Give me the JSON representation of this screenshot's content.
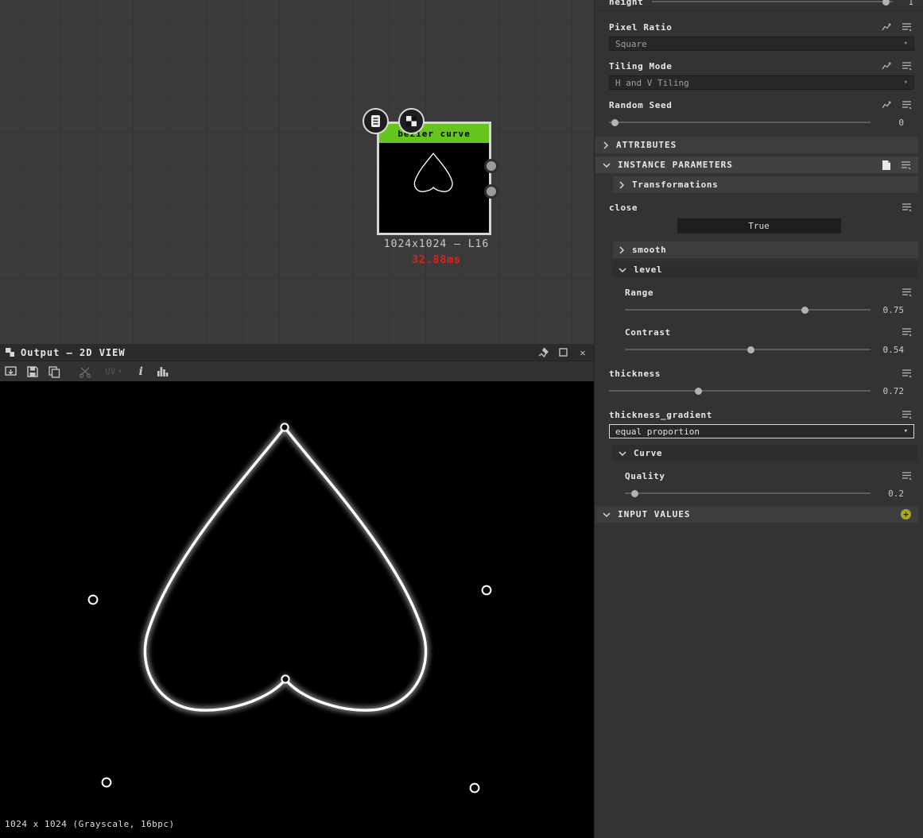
{
  "graph": {
    "node_title": "bezier curve",
    "node_resolution": "1024x1024 — L16",
    "node_time": "32.88ms"
  },
  "viewer": {
    "title": "Output — 2D VIEW",
    "uv_label": "UV",
    "status": "1024 x 1024 (Grayscale, 16bpc)"
  },
  "props": {
    "height": {
      "label": "height",
      "value": "1"
    },
    "pixel_ratio": {
      "label": "Pixel Ratio",
      "value": "Square"
    },
    "tiling_mode": {
      "label": "Tiling Mode",
      "value": "H and V Tiling"
    },
    "random_seed": {
      "label": "Random Seed",
      "value": "0"
    },
    "attributes": {
      "label": "ATTRIBUTES"
    },
    "instance_parameters": {
      "label": "INSTANCE PARAMETERS"
    },
    "transformations": {
      "label": "Transformations"
    },
    "close": {
      "label": "close",
      "value": "True"
    },
    "smooth": {
      "label": "smooth"
    },
    "level": {
      "label": "level"
    },
    "range": {
      "label": "Range",
      "value": "0.75"
    },
    "contrast": {
      "label": "Contrast",
      "value": "0.54"
    },
    "thickness": {
      "label": "thickness",
      "value": "0.72"
    },
    "thickness_gradient": {
      "label": "thickness_gradient",
      "value": "equal proportion"
    },
    "curve": {
      "label": "Curve"
    },
    "quality": {
      "label": "Quality",
      "value": "0.2"
    },
    "input_values": {
      "label": "INPUT VALUES"
    }
  },
  "icons": {
    "close": "✕",
    "dropdown_arrow": "▾",
    "plus": "+",
    "info": "i"
  },
  "colors": {
    "node_header_green": "#67c31d",
    "render_time_red": "#e0231c",
    "panel_bg": "#333333",
    "graph_bg": "#3b3b3b",
    "curve_stroke": "#ffffff"
  }
}
